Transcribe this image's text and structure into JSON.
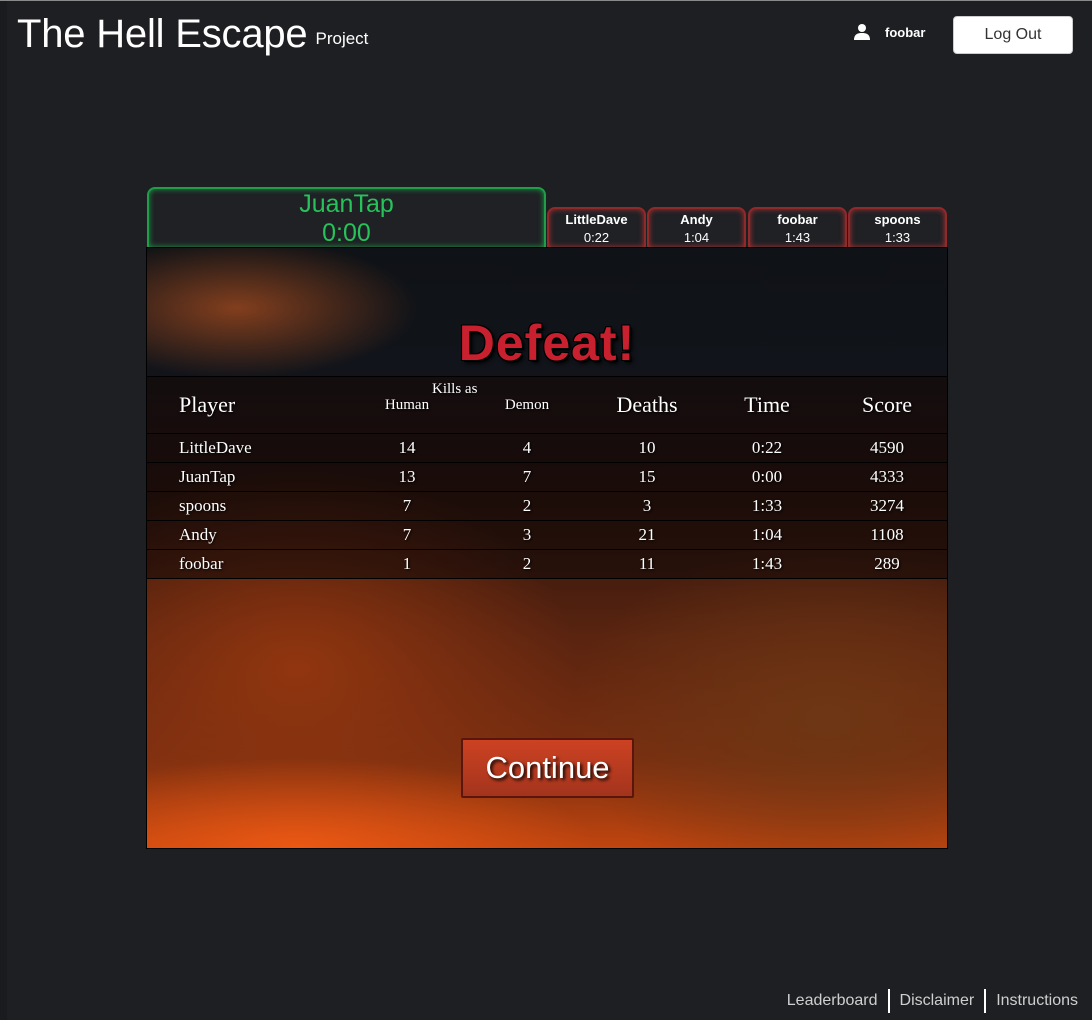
{
  "header": {
    "title": "The Hell Escape",
    "subtitle": "Project",
    "user": {
      "icon": "user-icon",
      "name": "foobar"
    },
    "logout_label": "Log Out"
  },
  "game": {
    "current_player": {
      "name": "JuanTap",
      "time": "0:00",
      "status_color": "#27c25a"
    },
    "other_players": [
      {
        "name": "LittleDave",
        "time": "0:22"
      },
      {
        "name": "Andy",
        "time": "1:04"
      },
      {
        "name": "foobar",
        "time": "1:43"
      },
      {
        "name": "spoons",
        "time": "1:33"
      }
    ],
    "result_title": "Defeat!",
    "result_color": "#c8202e",
    "table": {
      "headers": {
        "player": "Player",
        "kills_group": "Kills as",
        "kills_human": "Human",
        "kills_demon": "Demon",
        "deaths": "Deaths",
        "time": "Time",
        "score": "Score"
      },
      "rows": [
        {
          "player": "LittleDave",
          "human": "14",
          "demon": "4",
          "deaths": "10",
          "time": "0:22",
          "score": "4590"
        },
        {
          "player": "JuanTap",
          "human": "13",
          "demon": "7",
          "deaths": "15",
          "time": "0:00",
          "score": "4333"
        },
        {
          "player": "spoons",
          "human": "7",
          "demon": "2",
          "deaths": "3",
          "time": "1:33",
          "score": "3274"
        },
        {
          "player": "Andy",
          "human": "7",
          "demon": "3",
          "deaths": "21",
          "time": "1:04",
          "score": "1108"
        },
        {
          "player": "foobar",
          "human": "1",
          "demon": "2",
          "deaths": "11",
          "time": "1:43",
          "score": "289"
        }
      ]
    },
    "continue_label": "Continue"
  },
  "footer": {
    "links": [
      "Leaderboard",
      "Disclaimer",
      "Instructions"
    ]
  }
}
